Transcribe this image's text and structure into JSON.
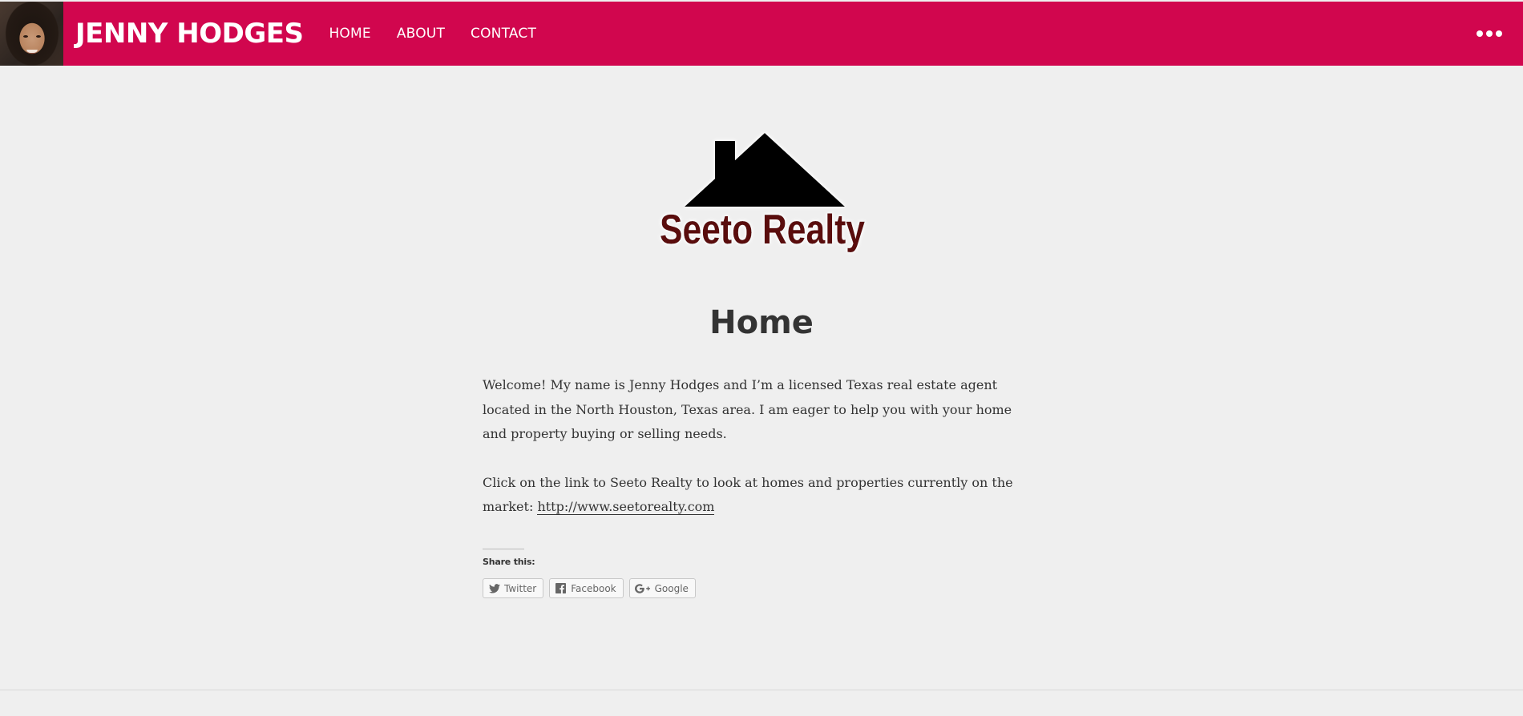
{
  "header": {
    "site_title": "JENNY HODGES",
    "nav": [
      {
        "label": "HOME"
      },
      {
        "label": "ABOUT"
      },
      {
        "label": "CONTACT"
      }
    ],
    "more_icon": "ellipsis-icon",
    "background_color": "#d1064e"
  },
  "logo": {
    "text": "Seeto Realty",
    "icon": "house-roof-icon"
  },
  "main": {
    "page_title": "Home",
    "paragraph_1": "Welcome! My name is Jenny Hodges and I’m a licensed Texas real estate agent located in the North Houston, Texas area. I am eager to help you with your home and property buying or selling needs.",
    "paragraph_2_text": "Click on the link to Seeto Realty to look at homes and properties currently on the market:",
    "paragraph_2_link": "http://www.seetorealty.com"
  },
  "share": {
    "heading": "Share this:",
    "buttons": [
      {
        "label": "Twitter",
        "icon": "twitter-icon"
      },
      {
        "label": "Facebook",
        "icon": "facebook-icon"
      },
      {
        "label": "Google",
        "icon": "google-plus-icon"
      }
    ]
  }
}
